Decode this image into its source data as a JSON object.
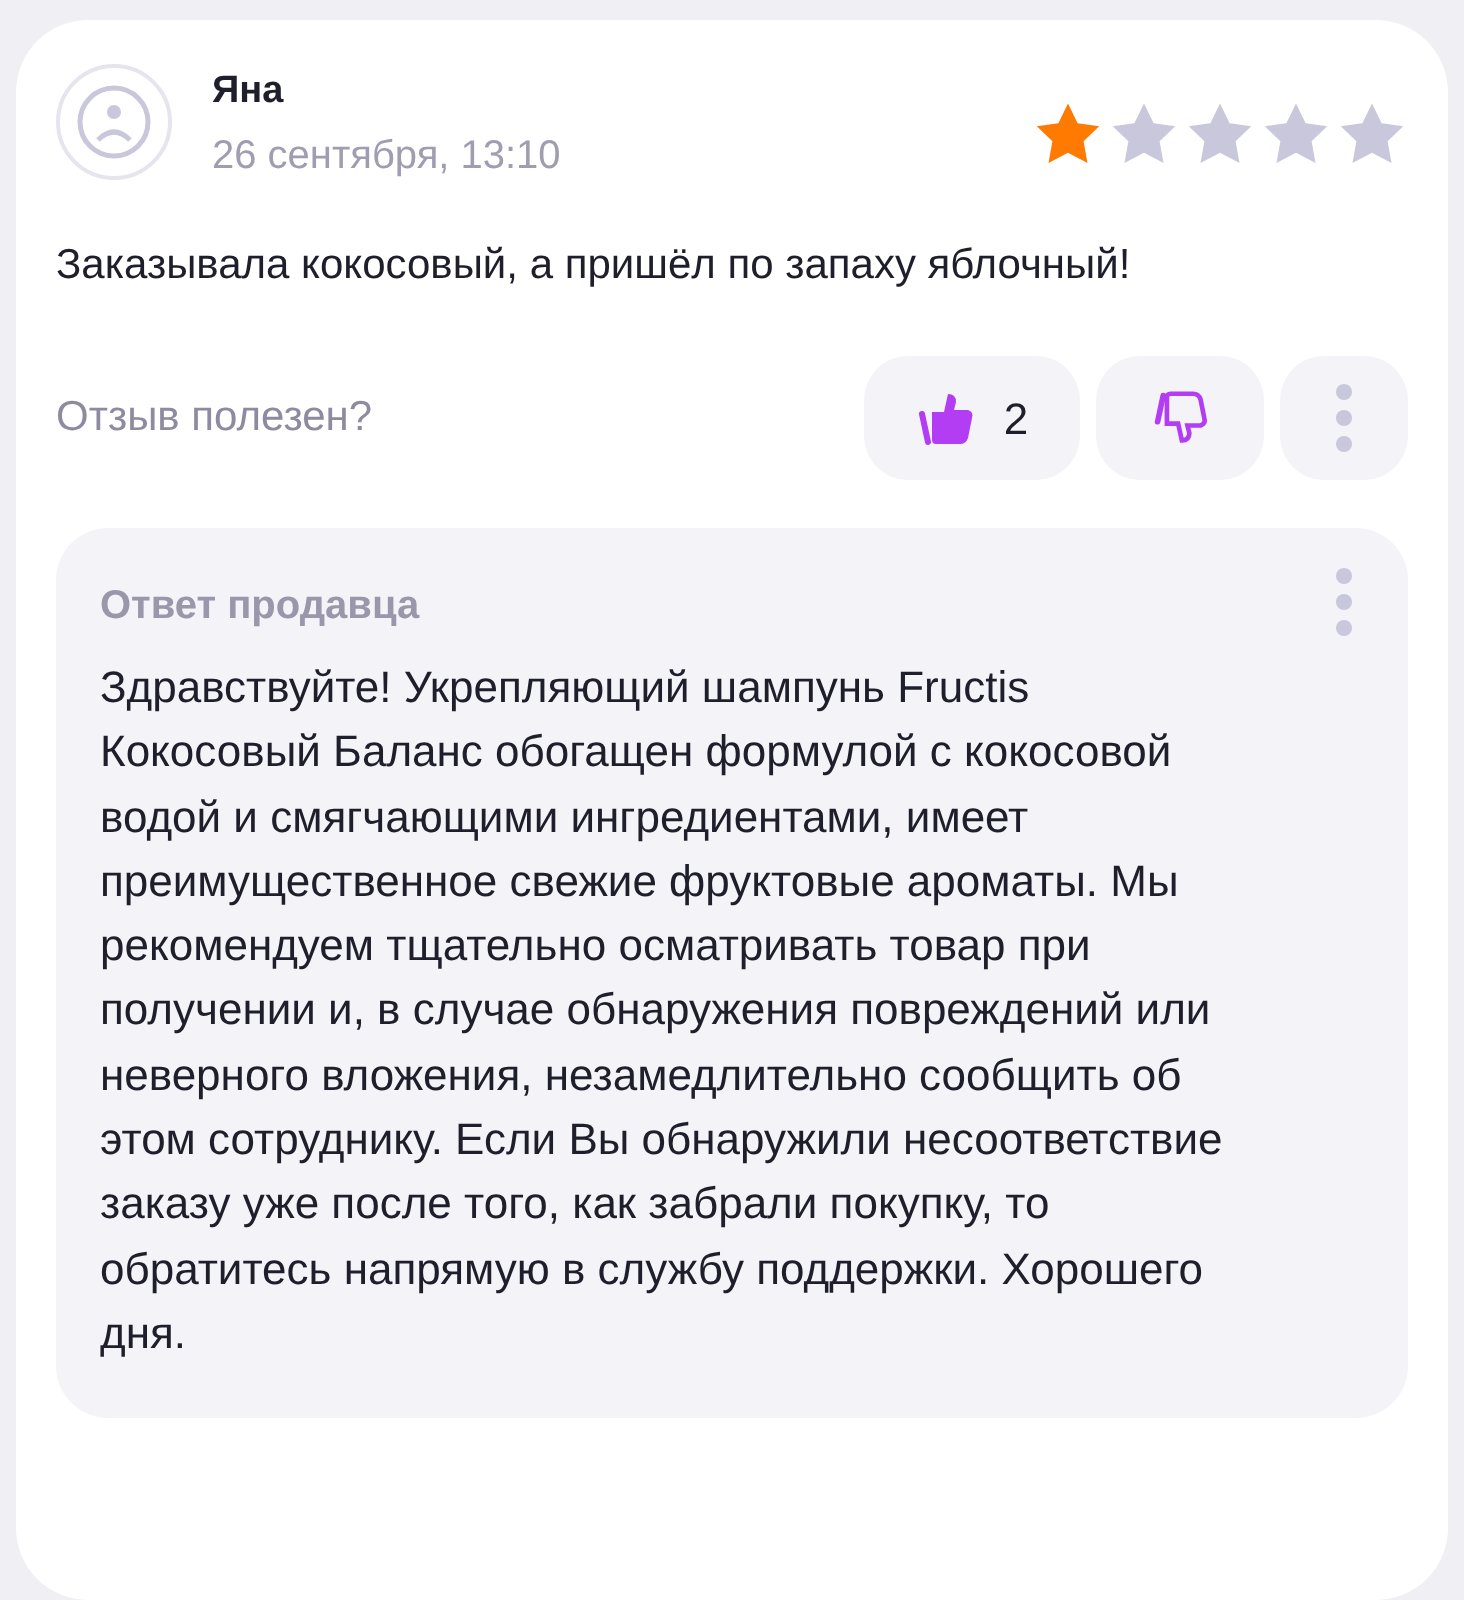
{
  "review": {
    "author": "Яна",
    "date": "26 сентября, 13:10",
    "stars": 1,
    "text": "Заказывала кокосовый, а пришёл по запаху яблочный!",
    "helpful_prompt": "Отзыв полезен?",
    "like": {
      "count": "2",
      "selected": true
    },
    "dislike": {
      "selected": false
    }
  },
  "seller_reply": {
    "title": "Ответ продавца",
    "text": "Здравствуйте! Укрепляющий шампунь Fructis Кокосовый Баланс обогащен формулой с кокосовой водой и смягчающими ингредиентами, имеет преимущественное свежие фруктовые ароматы. Мы рекомендуем тщательно осматривать товар при получении и, в случае обнаружения повреждений или неверного вложения, незамедлительно сообщить об этом сотруднику. Если Вы обнаружили несоответствие заказу уже после того, как забрали покупку, то обратитесь напрямую в службу поддержки. Хорошего дня."
  }
}
